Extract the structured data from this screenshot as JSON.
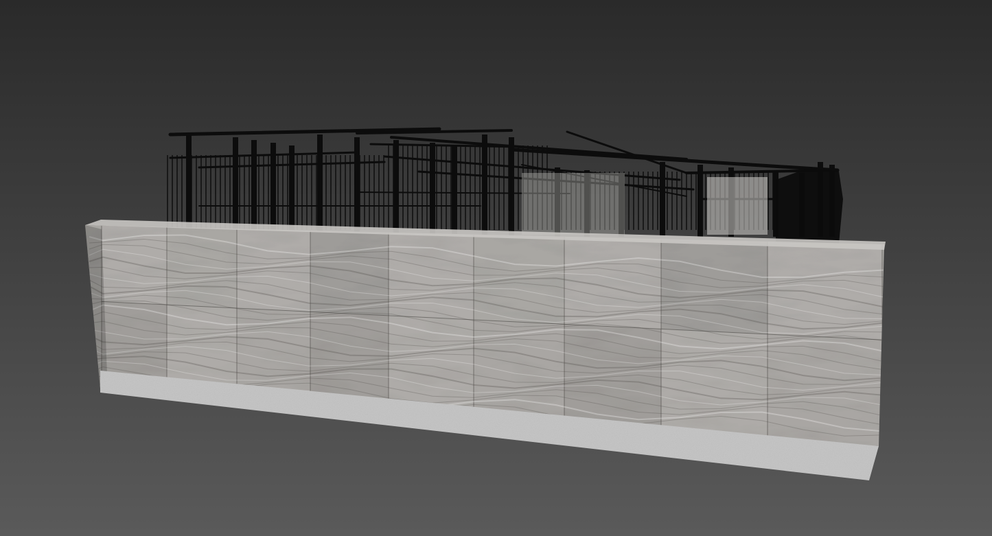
{
  "viewport": {
    "background_top": "#2a2a2a",
    "background_bottom": "#5a5a5a"
  },
  "scene": {
    "railing_color": "#0c0c0c",
    "marble_light": "#d2d0cc",
    "marble_mid": "#a9a7a3",
    "marble_dark": "#5f5c59",
    "marble_vein": "#4a4744",
    "concrete_color": "#c3c3c3",
    "concrete_shadow": "#9c9c9c",
    "upper_row_tiles": 9,
    "lower_row_tiles": 9
  }
}
